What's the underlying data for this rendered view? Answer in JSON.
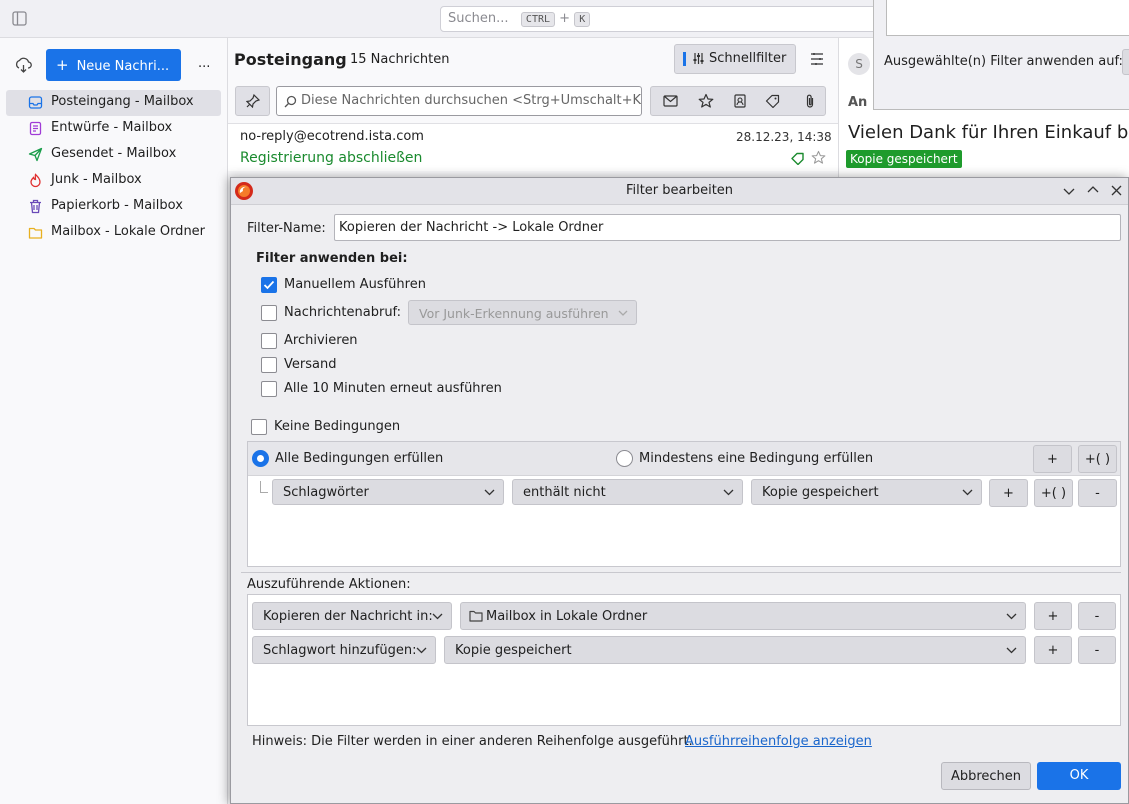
{
  "topbar": {
    "search_placeholder": "Suchen...",
    "kbd_ctrl": "CTRL",
    "kbd_plus": "+",
    "kbd_k": "K"
  },
  "sidebar": {
    "new_message_label": "Neue Nachri...",
    "more_label": "...",
    "folders": [
      {
        "label": "Posteingang - Mailbox",
        "icon": "inbox-icon",
        "color": "#1a73e8"
      },
      {
        "label": "Entwürfe - Mailbox",
        "icon": "drafts-icon",
        "color": "#a03cd6"
      },
      {
        "label": "Gesendet - Mailbox",
        "icon": "sent-icon",
        "color": "#1a9e4b"
      },
      {
        "label": "Junk - Mailbox",
        "icon": "junk-icon",
        "color": "#e03030"
      },
      {
        "label": "Papierkorb - Mailbox",
        "icon": "trash-icon",
        "color": "#6a4ab8"
      },
      {
        "label": "Mailbox - Lokale Ordner",
        "icon": "folder-icon",
        "color": "#e8b020"
      }
    ]
  },
  "message_list": {
    "folder_title": "Posteingang",
    "count_label": "15 Nachrichten",
    "quickfilter_label": "Schnellfilter",
    "search_placeholder": "Diese Nachrichten durchsuchen <Strg+Umschalt+K>",
    "message": {
      "sender": "no-reply@ecotrend.ista.com",
      "date": "28.12.23, 14:38",
      "subject": "Registrierung abschließen"
    }
  },
  "reader": {
    "avatar_letter": "S",
    "to_label": "An",
    "subject": "Vielen Dank für Ihren Einkauf bei",
    "tag_label": "Kopie gespeichert"
  },
  "other_dialog": {
    "apply_label": "Ausgewählte(n) Filter anwenden auf:"
  },
  "dialog": {
    "title": "Filter bearbeiten",
    "filter_name_label": "Filter-Name:",
    "filter_name_value": "Kopieren der Nachricht -> Lokale Ordner",
    "apply_when_label": "Filter anwenden bei:",
    "options": {
      "manual": "Manuellem Ausführen",
      "fetch": "Nachrichtenabruf:",
      "fetch_select": "Vor Junk-Erkennung ausführen",
      "archive": "Archivieren",
      "send": "Versand",
      "periodic": "Alle 10 Minuten erneut ausführen"
    },
    "no_conditions_label": "Keine Bedingungen",
    "match_all_label": "Alle Bedingungen erfüllen",
    "match_any_label": "Mindestens eine Bedingung erfüllen",
    "plus_label": "+",
    "plus_group_label": "+( )",
    "minus_label": "-",
    "condition": {
      "field": "Schlagwörter",
      "operator": "enthält nicht",
      "value": "Kopie gespeichert"
    },
    "actions_label": "Auszuführende Aktionen:",
    "actions": [
      {
        "type": "Kopieren der Nachricht in:",
        "target": "Mailbox in Lokale Ordner"
      },
      {
        "type": "Schlagwort hinzufügen:",
        "target": "Kopie gespeichert"
      }
    ],
    "hint_text": "Hinweis: Die Filter werden in einer anderen Reihenfolge ausgeführt.",
    "hint_link": "Ausführreihenfolge anzeigen",
    "cancel_label": "Abbrechen",
    "ok_label": "OK"
  },
  "colors": {
    "accent": "#1a73e8",
    "green": "#1a8a2e",
    "tag_green": "#1e9b2c"
  }
}
